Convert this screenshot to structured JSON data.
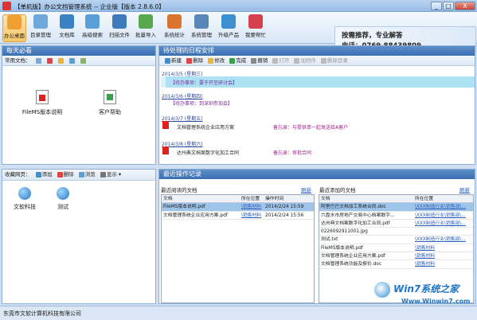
{
  "window": {
    "title": "【单机版】办公文档管理系统 -- 企业版【版本 2.8.6.0】",
    "min": "_",
    "max": "□",
    "close": "X"
  },
  "toolbar": {
    "items": [
      {
        "label": "办公桌面",
        "color": "#f0a030"
      },
      {
        "label": "目录管理",
        "color": "#6ea8dc"
      },
      {
        "label": "文档库",
        "color": "#3b82c4"
      },
      {
        "label": "高级搜索",
        "color": "#5a9fd8"
      },
      {
        "label": "扫描文件",
        "color": "#3d7bbd"
      },
      {
        "label": "批量导入",
        "color": "#59a84d"
      },
      {
        "label": "系统统计",
        "color": "#d9752f"
      },
      {
        "label": "系统管理",
        "color": "#5b86b8"
      },
      {
        "label": "升级产品",
        "color": "#3e8fd0"
      },
      {
        "label": "我要帮忙",
        "color": "#d4404d"
      }
    ]
  },
  "banner": {
    "line1": "按需推荐，专业解答",
    "line2": "电话：0769-88439809"
  },
  "desk": {
    "title": "每天必看",
    "common_docs_label": "常用文档：",
    "docs": [
      {
        "name": "FileMS版本说明"
      },
      {
        "name": "客户帮助"
      }
    ]
  },
  "favorites": {
    "label": "收藏网页：",
    "add": "添加",
    "delete": "删除",
    "browse": "浏览",
    "display": "显示",
    "items": [
      {
        "name": "文软科技"
      },
      {
        "name": "测试"
      }
    ]
  },
  "schedule": {
    "title": "待处理的日程安排",
    "new": "新建",
    "delete": "删除",
    "modify": "修改",
    "done": "完成",
    "undo": "撤销",
    "open": "打开",
    "attach": "加附件",
    "remove_dir": "删除目录",
    "entries": [
      {
        "date": "2014/3/5 (星期三)",
        "text": "【待办事项：要于开至研讨会】",
        "kind": "todo"
      },
      {
        "date": "2014/3/6 (星期四)",
        "text": "【待办事项：到深圳参加会】",
        "kind": "todo"
      },
      {
        "date": "2014/3/7 (星期五)",
        "text": "文档管理系统企业应用方案",
        "note": "备忘录：与提供单一起发送给A客户",
        "kind": "doc"
      },
      {
        "date": "2014/3/8 (星期六)",
        "text": "达州典文档案数字化加工合同",
        "note": "备忘录：审批合同",
        "kind": "doc"
      }
    ]
  },
  "recent": {
    "title": "最近操作记录",
    "read": {
      "title": "最近阅读的文档",
      "refresh": "刷新",
      "columns": [
        "文档",
        "所在位置",
        "操作时间"
      ],
      "rows": [
        [
          "FileMS版本说明.pdf",
          "\\销售材料",
          "2014/2/24 15:59"
        ],
        [
          "文档管理系统企业应用方案.pdf",
          "\\销售材料",
          "2014/2/24 15:56"
        ]
      ]
    },
    "added": {
      "title": "最近添加的文档",
      "refresh": "刷新",
      "columns": [
        "文档",
        "所在位置"
      ],
      "rows": [
        [
          "阿里巴巴文档加工系统合同.doc",
          "\\XXX制造行业\\销售部\\..."
        ],
        [
          "六盘水市房地产交易中心档案数字...",
          "\\XXX制造行业\\销售部\\..."
        ],
        [
          "达州典文档案数字化加工合同.pdf",
          "\\XXX制造行业\\销售部\\..."
        ],
        [
          "0226092911001.jpg",
          ""
        ],
        [
          "测试.txt",
          "\\XXX制造行业\\销售部\\..."
        ],
        [
          "FileMS版本说明.pdf",
          "\\销售材料"
        ],
        [
          "文档管理系统企业应用方案.pdf",
          "\\销售材料"
        ],
        [
          "文档管理系统功能及报价.doc",
          "\\销售材料"
        ]
      ]
    }
  },
  "status": {
    "company": "东莞市文软计算机科技有限公司"
  },
  "watermark": {
    "brand": "Win7系统之家",
    "url": "Www.Winwin7.com"
  }
}
